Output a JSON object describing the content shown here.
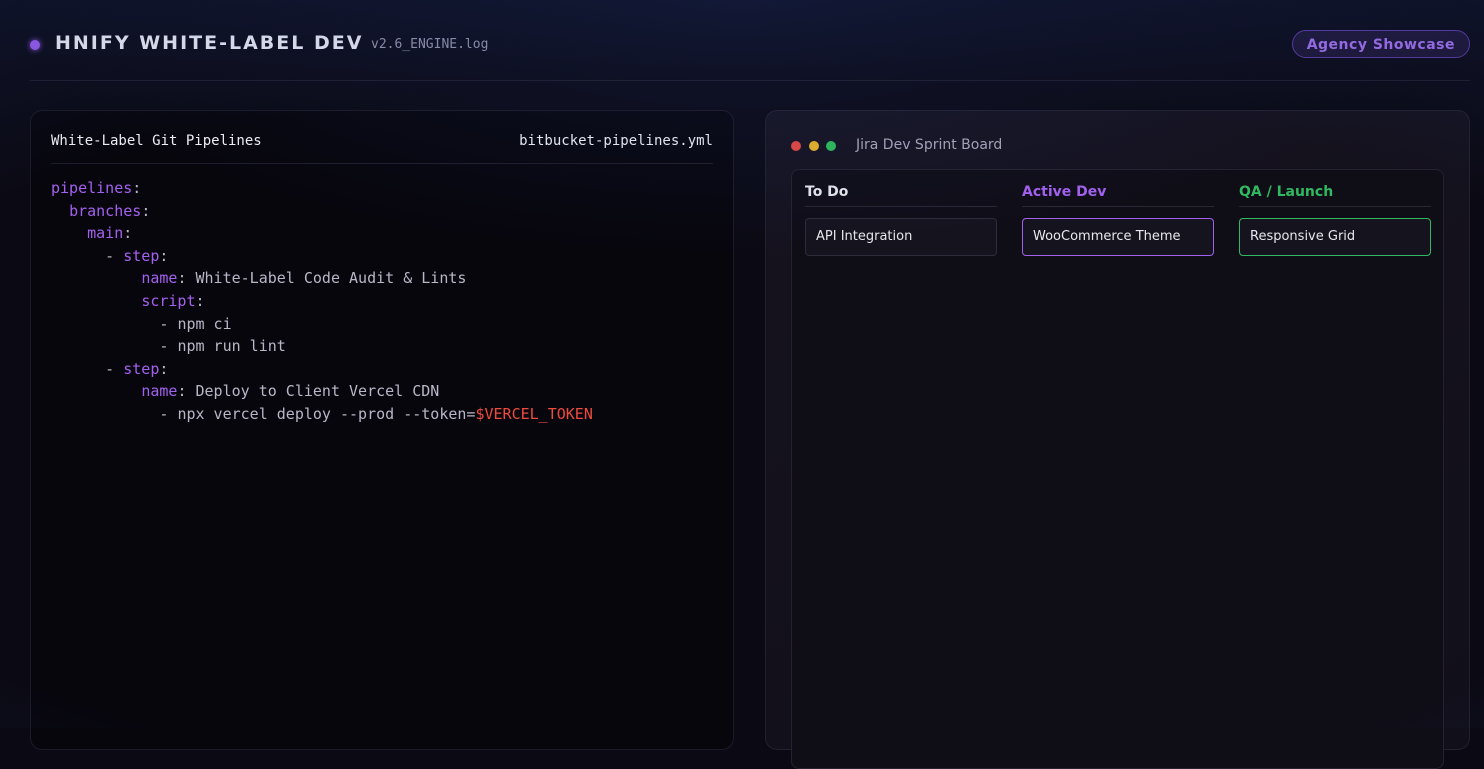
{
  "header": {
    "brand": "HNIFY WHITE-LABEL DEV",
    "version": "v2.6_ENGINE.log",
    "showcase_label": "Agency Showcase"
  },
  "code": {
    "title": "White-Label Git Pipelines",
    "filename": "bitbucket-pipelines.yml",
    "lines": [
      {
        "indent": 0,
        "key": "pipelines",
        "sep": ":",
        "val": ""
      },
      {
        "indent": 1,
        "key": "branches",
        "sep": ":",
        "val": ""
      },
      {
        "indent": 2,
        "key": "main",
        "sep": ":",
        "val": ""
      },
      {
        "indent": 3,
        "pre": "- ",
        "key": "step",
        "sep": ":",
        "val": ""
      },
      {
        "indent": 5,
        "key": "name",
        "sep": ": ",
        "val": "White-Label Code Audit & Lints"
      },
      {
        "indent": 5,
        "key": "script",
        "sep": ":",
        "val": ""
      },
      {
        "indent": 6,
        "pre": "- ",
        "key": "",
        "sep": "",
        "val": "npm ci"
      },
      {
        "indent": 6,
        "pre": "- ",
        "key": "",
        "sep": "",
        "val": "npm run lint"
      },
      {
        "indent": 3,
        "pre": "- ",
        "key": "step",
        "sep": ":",
        "val": ""
      },
      {
        "indent": 5,
        "key": "name",
        "sep": ": ",
        "val": "Deploy to Client Vercel CDN"
      },
      {
        "indent": 6,
        "pre": "- ",
        "key": "",
        "sep": "",
        "val": "npx vercel deploy --prod --token=",
        "token": "$VERCEL_TOKEN"
      }
    ]
  },
  "board": {
    "title": "Jira Dev Sprint Board",
    "columns": [
      {
        "title": "To Do",
        "color": "#e8e8ee",
        "card": "API Integration",
        "card_border": "#2e2b3a"
      },
      {
        "title": "Active Dev",
        "color": "#a461ef",
        "card": "WooCommerce Theme",
        "card_border": "#a461ef"
      },
      {
        "title": "QA / Launch",
        "color": "#2fb960",
        "card": "Responsive Grid",
        "card_border": "#2fb960"
      }
    ]
  },
  "colors": {
    "accent": "#a461ef",
    "token": "#ef4a3e",
    "success": "#2fb960"
  }
}
